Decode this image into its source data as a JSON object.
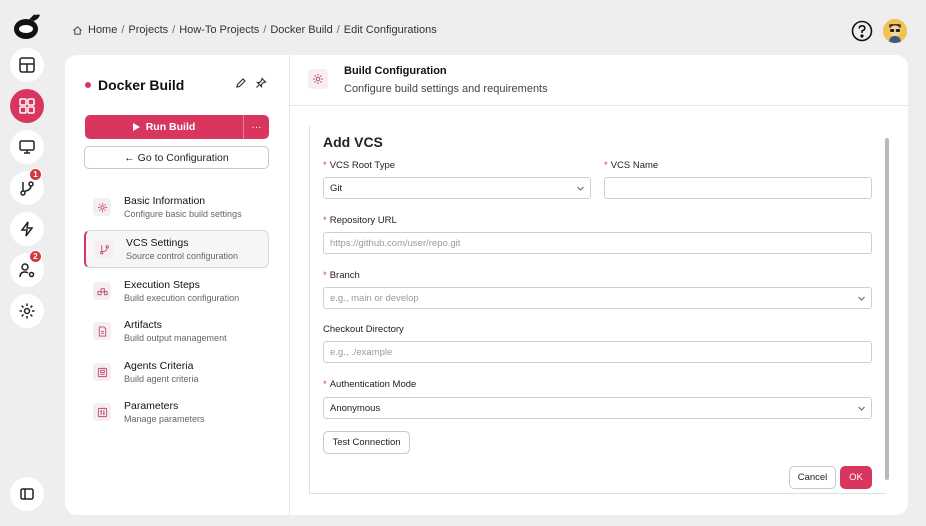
{
  "breadcrumb": {
    "items": [
      "Home",
      "Projects",
      "How-To Projects",
      "Docker Build",
      "Edit Configurations"
    ],
    "separator": "/"
  },
  "rail": {
    "badges": {
      "vcs": "1",
      "agents": "2"
    }
  },
  "project": {
    "name": "Docker Build",
    "run_label": "Run Build",
    "more_label": "···",
    "goto_label": "← Go to Configuration"
  },
  "nav": [
    {
      "title": "Basic Information",
      "subtitle": "Configure basic build settings",
      "icon": "gear-icon"
    },
    {
      "title": "VCS Settings",
      "subtitle": "Source control configuration",
      "icon": "branch-icon"
    },
    {
      "title": "Execution Steps",
      "subtitle": "Build execution configuration",
      "icon": "steps-icon"
    },
    {
      "title": "Artifacts",
      "subtitle": "Build output management",
      "icon": "file-icon"
    },
    {
      "title": "Agents Criteria",
      "subtitle": "Build agent criteria",
      "icon": "agent-icon"
    },
    {
      "title": "Parameters",
      "subtitle": "Manage parameters",
      "icon": "sliders-icon"
    }
  ],
  "header": {
    "title": "Build Configuration",
    "subtitle": "Configure build settings and requirements"
  },
  "form": {
    "title": "Add VCS",
    "required_mark": "*",
    "vcs_root_type": {
      "label": "VCS Root Type",
      "value": "Git"
    },
    "vcs_name": {
      "label": "VCS Name",
      "value": ""
    },
    "repo_url": {
      "label": "Repository URL",
      "placeholder": "https://github.com/user/repo.git"
    },
    "branch": {
      "label": "Branch",
      "placeholder": "e.g., main or develop"
    },
    "checkout_dir": {
      "label": "Checkout Directory",
      "placeholder": "e.g., ./example"
    },
    "auth_mode": {
      "label": "Authentication Mode",
      "value": "Anonymous"
    },
    "test_label": "Test Connection",
    "cancel_label": "Cancel",
    "ok_label": "OK"
  },
  "colors": {
    "accent": "#d8365e",
    "badge": "#d13a3a",
    "background": "#eeeeee"
  }
}
